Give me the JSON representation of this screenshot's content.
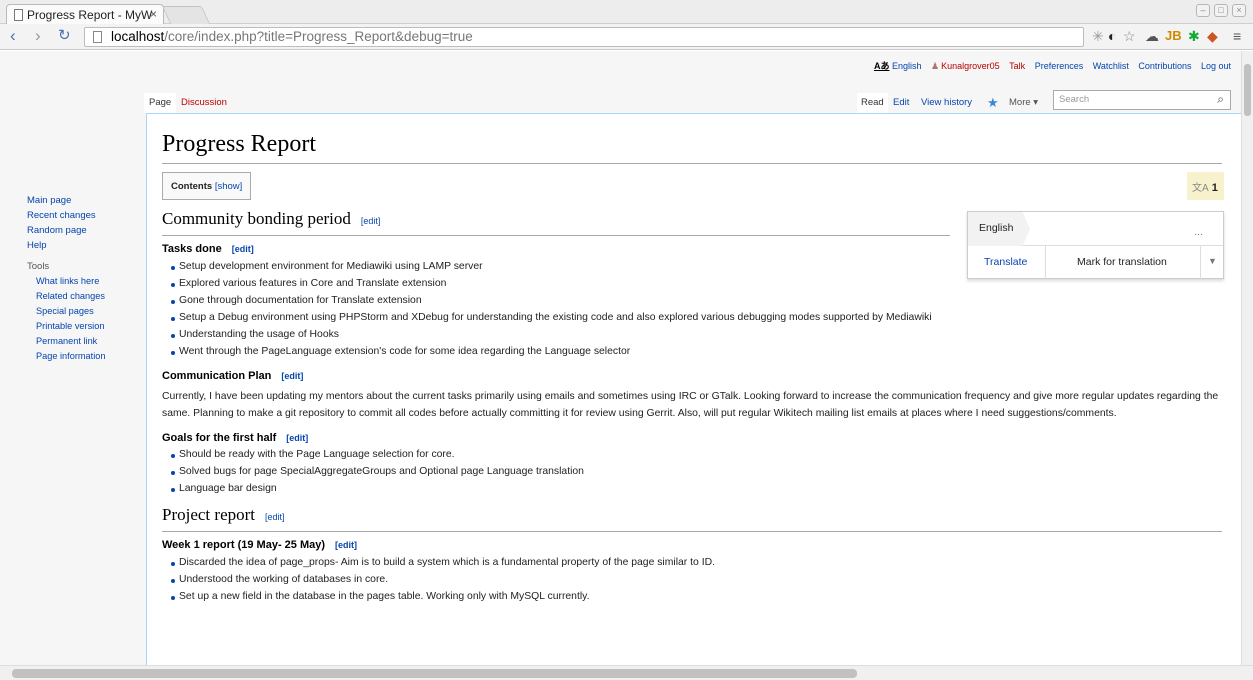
{
  "browser": {
    "tab_title": "Progress Report - MyW",
    "tab_close": "×",
    "url_host": "localhost",
    "url_path": "/core/index.php?title=Progress_Report&debug=true"
  },
  "personal": {
    "lang_glyph": "Aあ",
    "language": "English",
    "username": "Kunalgrover05",
    "talk": "Talk",
    "preferences": "Preferences",
    "watchlist": "Watchlist",
    "contributions": "Contributions",
    "logout": "Log out"
  },
  "tabs": {
    "page": "Page",
    "discussion": "Discussion",
    "read": "Read",
    "edit": "Edit",
    "history": "View history",
    "more": "More"
  },
  "search": {
    "placeholder": "Search"
  },
  "sidebar": {
    "main": [
      "Main page",
      "Recent changes",
      "Random page",
      "Help"
    ],
    "tools_heading": "Tools",
    "tools": [
      "What links here",
      "Related changes",
      "Special pages",
      "Printable version",
      "Permanent link",
      "Page information"
    ]
  },
  "title": "Progress Report",
  "toc": {
    "label": "Contents",
    "toggle": "[show]"
  },
  "translate_badge": {
    "glyph": "文A",
    "count": "1"
  },
  "langbox": {
    "language": "English",
    "more": "...",
    "translate": "Translate",
    "mark": "Mark for translation"
  },
  "edit_link": "[edit]",
  "sections": {
    "community": "Community bonding period",
    "tasks": "Tasks done",
    "tasks_items": [
      "Setup development environment for Mediawiki using LAMP server",
      "Explored various features in Core and Translate extension",
      "Gone through documentation for Translate extension",
      "Setup a Debug environment using PHPStorm and XDebug for understanding the existing code and also explored various debugging modes supported by Mediawiki",
      "Understanding the usage of Hooks",
      "Went through the PageLanguage extension's code for some idea regarding the Language selector"
    ],
    "comm": "Communication Plan",
    "comm_text": "Currently, I have been updating my mentors about the current tasks primarily using emails and sometimes using IRC or GTalk. Looking forward to increase the communication frequency and give more regular updates regarding the same. Planning to make a git repository to commit all codes before actually committing it for review using Gerrit. Also, will put regular Wikitech mailing list emails at places where I need suggestions/comments.",
    "goals": "Goals for the first half",
    "goals_items": [
      "Should be ready with the Page Language selection for core.",
      "Solved bugs for page SpecialAggregateGroups and Optional page Language translation",
      "Language bar design"
    ],
    "project": "Project report",
    "week1": "Week 1 report (19 May- 25 May)",
    "week1_items": [
      "Discarded the idea of page_props- Aim is to build a system which is a fundamental property of the page similar to ID.",
      "Understood the working of databases in core.",
      "Set up a new field in the database in the pages table. Working only with MySQL currently."
    ]
  }
}
